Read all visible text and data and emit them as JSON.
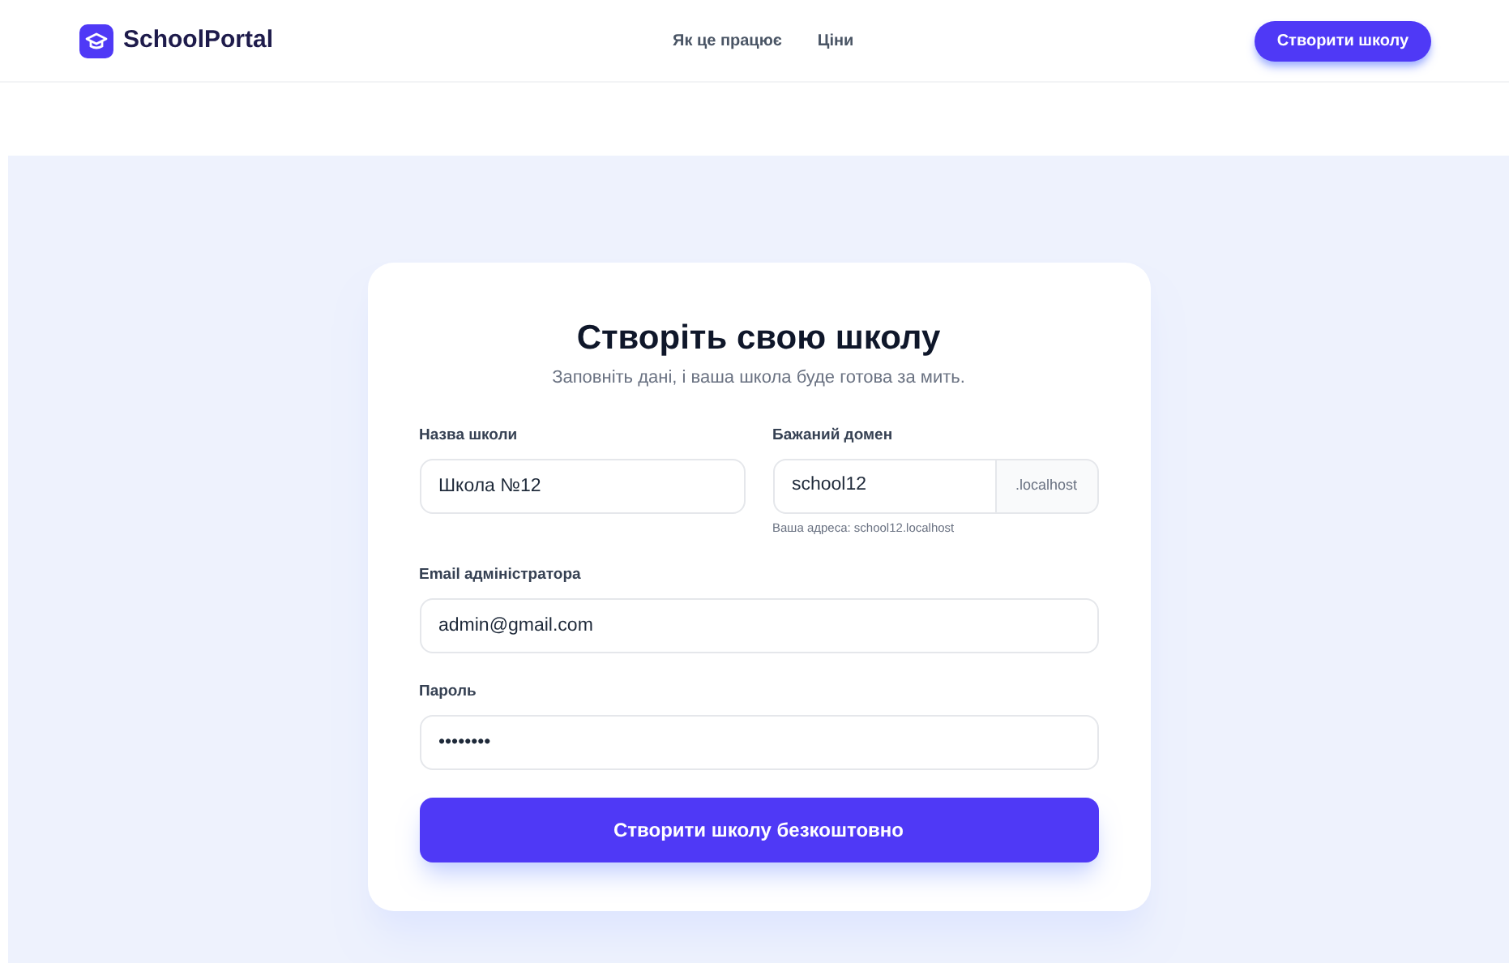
{
  "header": {
    "logo": "SchoolPortal",
    "nav": [
      "Як це працює",
      "Ціни"
    ],
    "cta": "Створити школу"
  },
  "form": {
    "title": "Створіть свою школу",
    "subtitle": "Заповніть дані, і ваша школа буде готова за мить.",
    "school_name": {
      "label": "Назва школи",
      "value": "Школа №12"
    },
    "domain": {
      "label": "Бажаний домен",
      "value": "school12",
      "suffix": ".localhost",
      "hint": "Ваша адреса: school12.localhost"
    },
    "email": {
      "label": "Email адміністратора",
      "value": "admin@gmail.com"
    },
    "password": {
      "label": "Пароль",
      "value": "••••••••"
    },
    "submit": "Створити школу безкоштовно"
  }
}
